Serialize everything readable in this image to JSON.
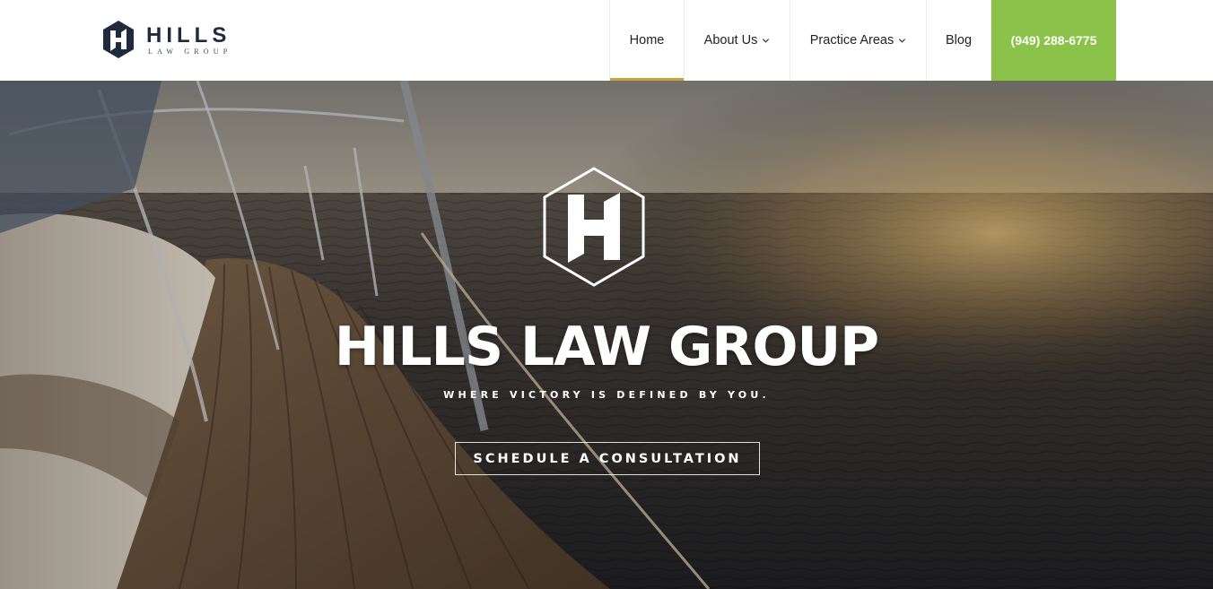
{
  "header": {
    "logo": {
      "name": "HILLS",
      "sub": "LAW GROUP",
      "icon": "hills-h-hexagon-icon",
      "color": "#1f2a3d"
    },
    "nav": {
      "home_label": "Home",
      "about_label": "About Us",
      "practice_label": "Practice Areas",
      "blog_label": "Blog",
      "phone_label": "(949) 288-6775",
      "active": "Home",
      "active_underline_color": "#c6a23b",
      "phone_bg_color": "#8bc34a",
      "dropdown_icon": "chevron-down-icon"
    }
  },
  "hero": {
    "emblem_icon": "hills-h-hexagon-icon",
    "title": "HILLS LAW GROUP",
    "tagline": "WHERE VICTORY IS DEFINED BY YOU.",
    "cta_label": "SCHEDULE A CONSULTATION",
    "background": "sailboat-deck-at-sunset-photo"
  }
}
